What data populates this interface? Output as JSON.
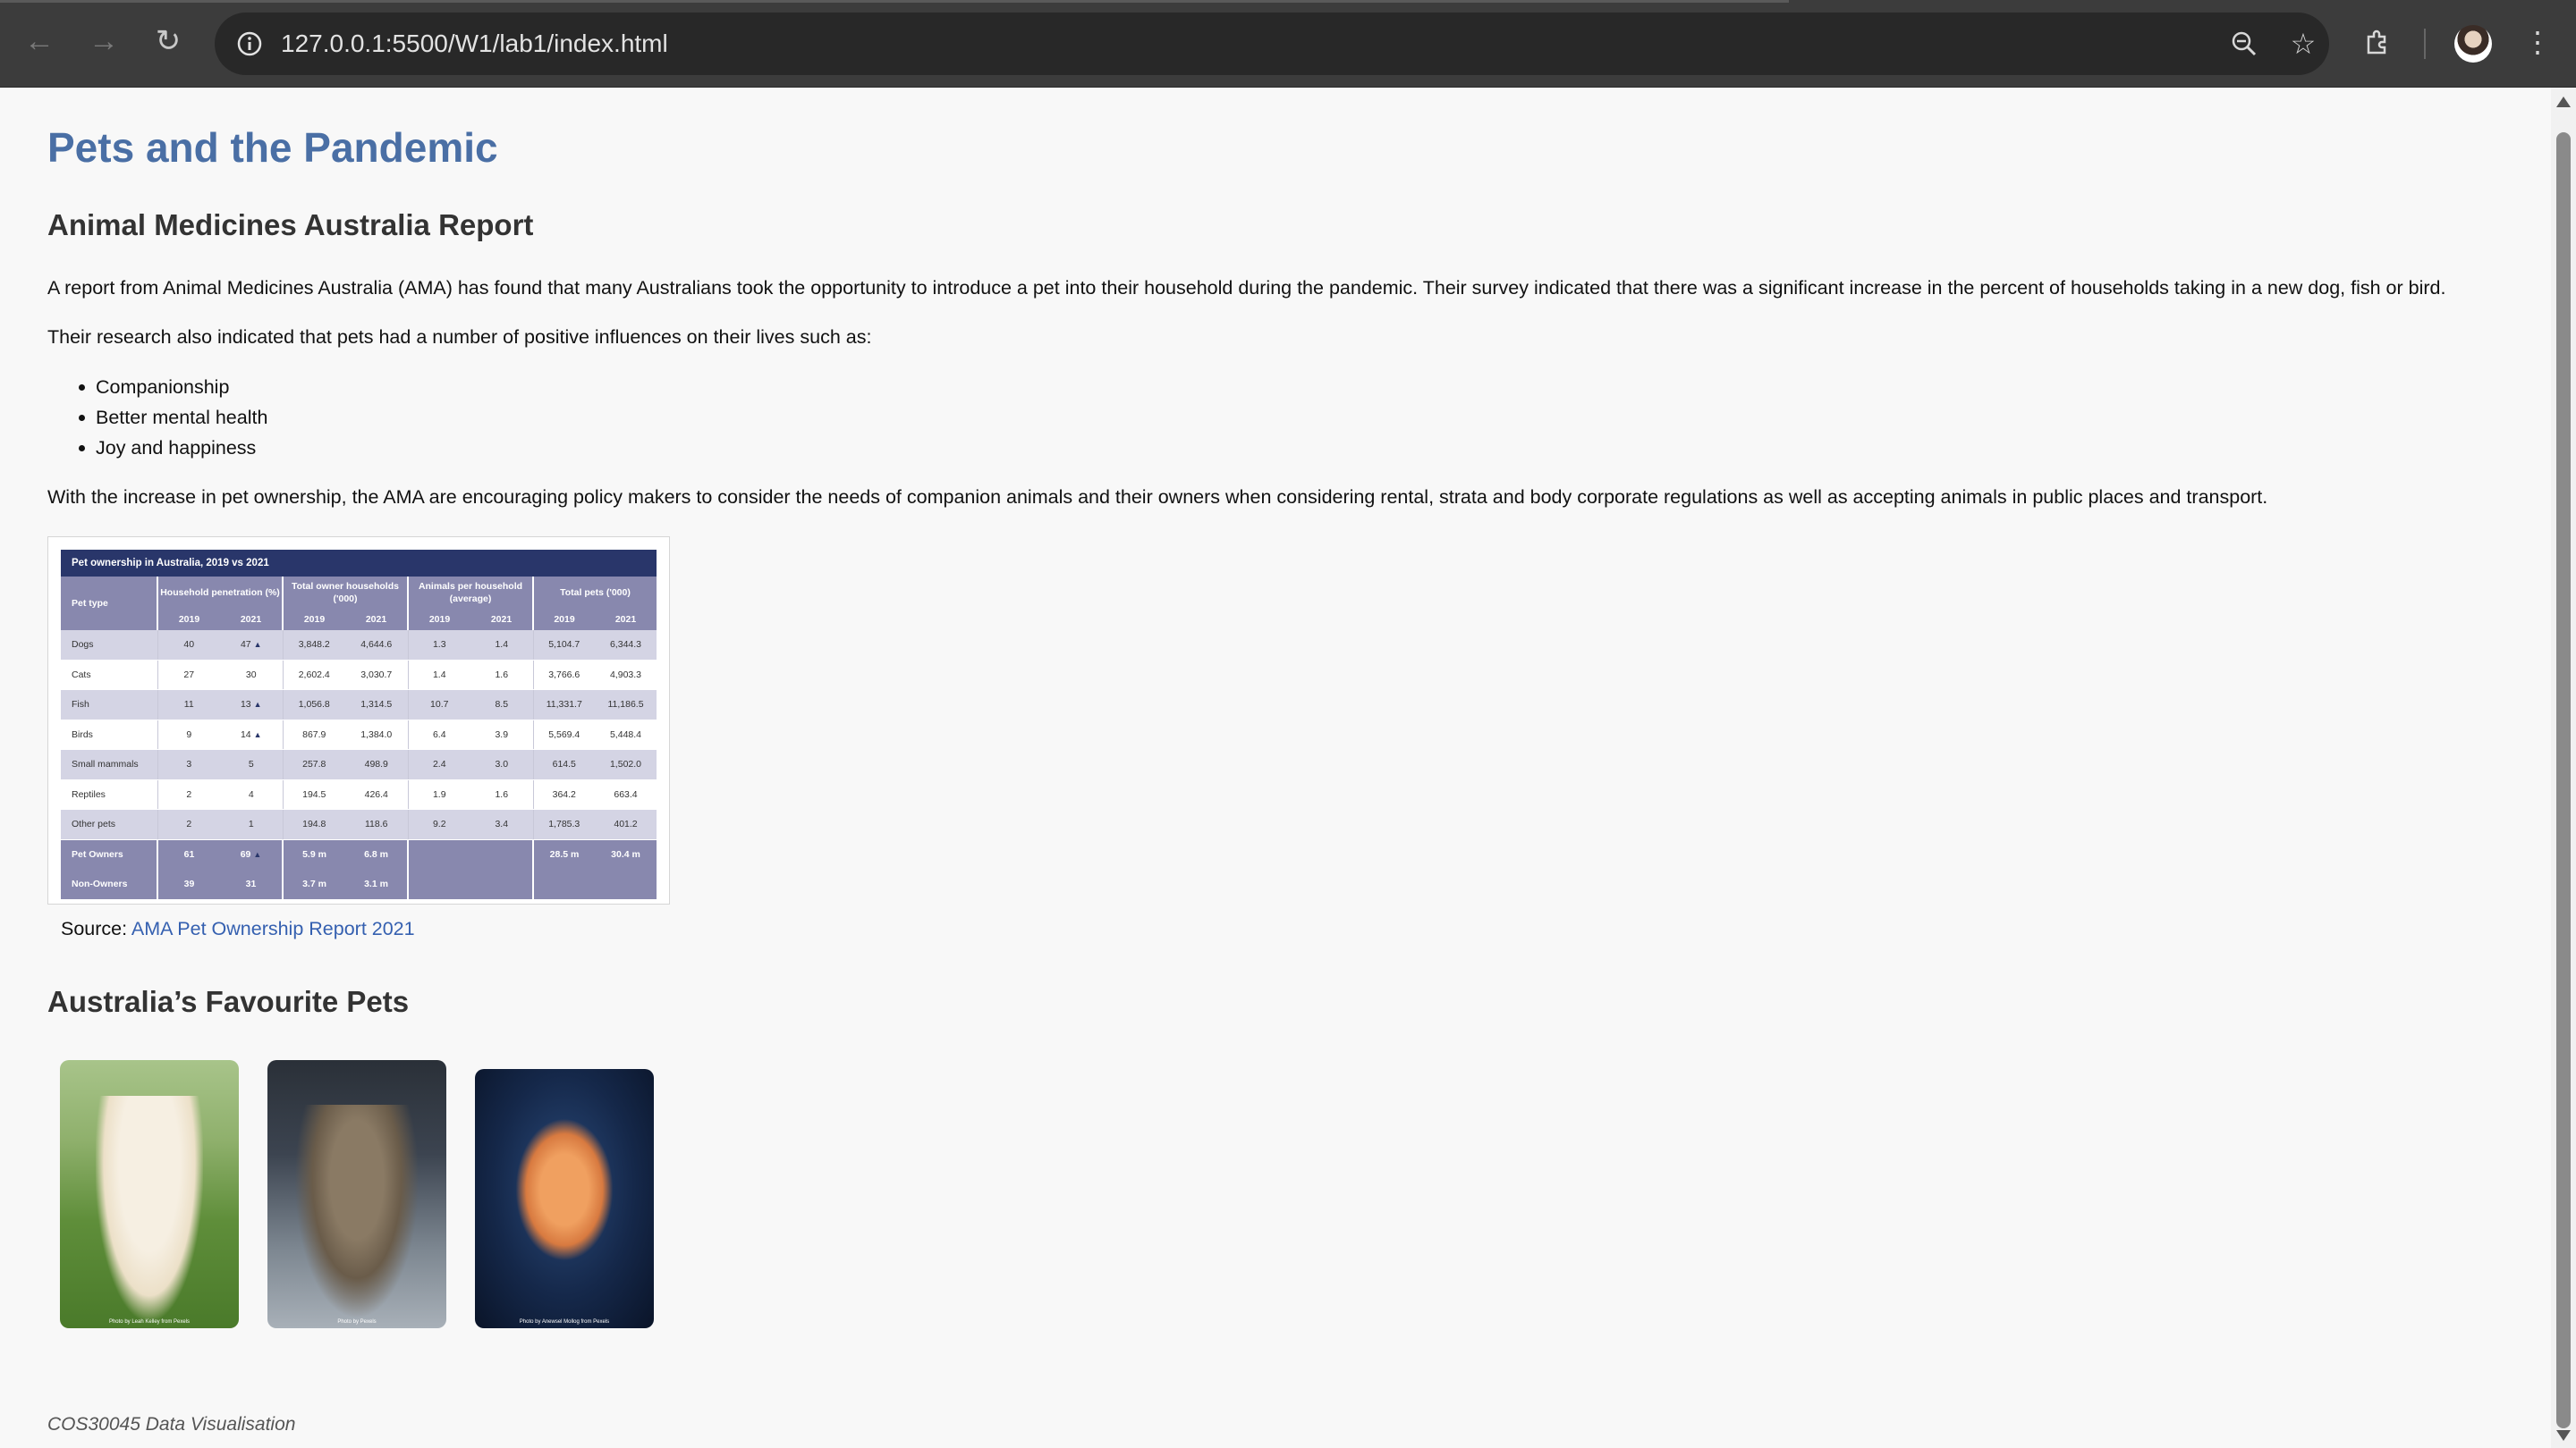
{
  "browser": {
    "url": "127.0.0.1:5500/W1/lab1/index.html"
  },
  "page": {
    "title": "Pets and the Pandemic",
    "subtitle": "Animal Medicines Australia Report",
    "para1": "A report from Animal Medicines Australia (AMA) has found that many Australians took the opportunity to introduce a pet into their household during the pandemic. Their survey indicated that there was a significant increase in the percent of households taking in a new dog, fish or bird.",
    "para2": "Their research also indicated that pets had a number of positive influences on their lives such as:",
    "bullets": [
      "Companionship",
      "Better mental health",
      "Joy and happiness"
    ],
    "para3": "With the increase in pet ownership, the AMA are encouraging policy makers to consider the needs of companion animals and their owners when considering rental, strata and body corporate regulations as well as accepting animals in public places and transport.",
    "source_prefix": "Source:",
    "source_link": "AMA Pet Ownership Report 2021",
    "favourites_heading": "Australia’s Favourite Pets",
    "footer": "COS30045 Data Visualisation"
  },
  "table": {
    "caption": "Pet ownership in Australia, 2019 vs 2021",
    "col_pet_type": "Pet type",
    "groups": [
      "Household penetration (%)",
      "Total owner households ('000)",
      "Animals per household (average)",
      "Total pets ('000)"
    ],
    "years": [
      "2019",
      "2021"
    ],
    "up_arrow": "▲",
    "rows": [
      {
        "name": "Dogs",
        "cells": [
          "40",
          "47",
          "3,848.2",
          "4,644.6",
          "1.3",
          "1.4",
          "5,104.7",
          "6,344.3"
        ],
        "up": true
      },
      {
        "name": "Cats",
        "cells": [
          "27",
          "30",
          "2,602.4",
          "3,030.7",
          "1.4",
          "1.6",
          "3,766.6",
          "4,903.3"
        ],
        "up": false
      },
      {
        "name": "Fish",
        "cells": [
          "11",
          "13",
          "1,056.8",
          "1,314.5",
          "10.7",
          "8.5",
          "11,331.7",
          "11,186.5"
        ],
        "up": true
      },
      {
        "name": "Birds",
        "cells": [
          "9",
          "14",
          "867.9",
          "1,384.0",
          "6.4",
          "3.9",
          "5,569.4",
          "5,448.4"
        ],
        "up": true
      },
      {
        "name": "Small mammals",
        "cells": [
          "3",
          "5",
          "257.8",
          "498.9",
          "2.4",
          "3.0",
          "614.5",
          "1,502.0"
        ],
        "up": false
      },
      {
        "name": "Reptiles",
        "cells": [
          "2",
          "4",
          "194.5",
          "426.4",
          "1.9",
          "1.6",
          "364.2",
          "663.4"
        ],
        "up": false
      },
      {
        "name": "Other pets",
        "cells": [
          "2",
          "1",
          "194.8",
          "118.6",
          "9.2",
          "3.4",
          "1,785.3",
          "401.2"
        ],
        "up": false
      }
    ],
    "summary": [
      {
        "name": "Pet Owners",
        "cells": [
          "61",
          "69",
          "5.9 m",
          "6.8 m",
          "",
          "",
          "28.5 m",
          "30.4 m"
        ],
        "up": true
      },
      {
        "name": "Non-Owners",
        "cells": [
          "39",
          "31",
          "3.7 m",
          "3.1 m",
          "",
          "",
          "",
          ""
        ],
        "up": false
      }
    ]
  },
  "photos": {
    "dog_credit": "Photo by Leah Kelley from Pexels",
    "cat_credit": "Photo by Pexels",
    "fish_credit": "Photo by Anewsel Mollog from Pexels"
  }
}
